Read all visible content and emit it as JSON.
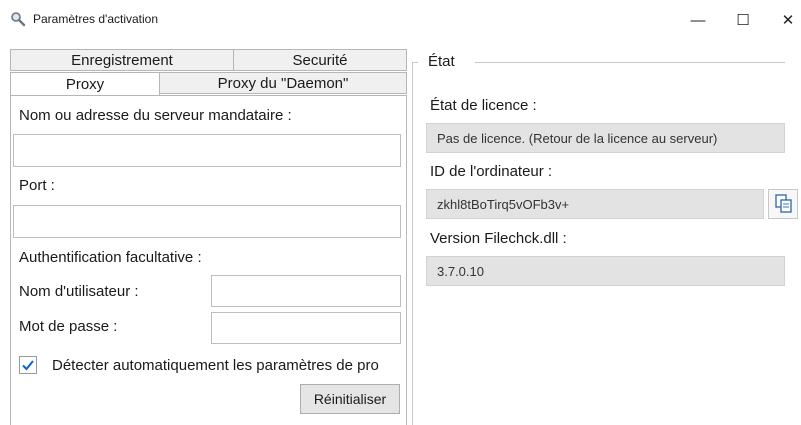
{
  "window": {
    "title": "Paramètres d'activation",
    "icon": "magnifier-icon",
    "controls": {
      "minimize": "—",
      "maximize": "☐",
      "close": "✕"
    }
  },
  "tabs": {
    "row_back": [
      "Enregistrement",
      "Securité"
    ],
    "row_front": [
      "Proxy",
      "Proxy du \"Daemon\""
    ],
    "active": "Proxy"
  },
  "proxy": {
    "server_label": "Nom ou adresse du serveur mandataire :",
    "server_value": "",
    "port_label": "Port :",
    "port_value": "",
    "auth_label": "Authentification facultative :",
    "username_label": "Nom d'utilisateur :",
    "username_value": "",
    "password_label": "Mot de passe :",
    "password_value": "",
    "autodetect_label": "Détecter automatiquement les paramètres de pro",
    "autodetect_checked": true,
    "reset_button": "Réinitialiser"
  },
  "state": {
    "group_title": "État",
    "license_label": "État de licence :",
    "license_value": "Pas de licence. (Retour de la licence au serveur)",
    "computer_id_label": "ID de l'ordinateur :",
    "computer_id_value": "zkhl8tBoTirq5vOFb3v+",
    "copy_icon": "copy-icon",
    "version_label": "Version Filechck.dll :",
    "version_value": "3.7.0.10"
  },
  "colors": {
    "accent": "#0a64c8",
    "readonly_bg": "#e3e3e3"
  }
}
